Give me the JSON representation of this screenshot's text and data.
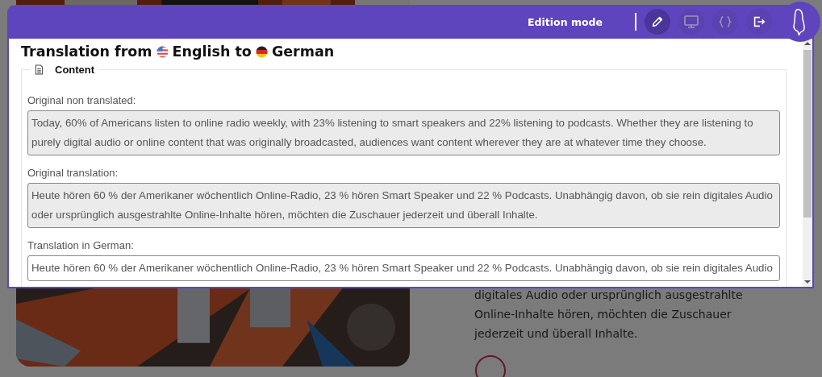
{
  "page": {
    "paragraph_lines": [
      "digitales Audio oder ursprünglich ausgestrahlte",
      "Online-Inhalte hören, möchten die Zuschauer",
      "jederzeit und überall Inhalte."
    ]
  },
  "toolbar": {
    "mode_label": "Edition mode",
    "tools": [
      {
        "kind": "edit",
        "selected": true
      },
      {
        "kind": "preview",
        "selected": false
      },
      {
        "kind": "code",
        "selected": false
      },
      {
        "kind": "exit",
        "selected": false
      }
    ]
  },
  "dialog": {
    "title_parts": [
      "Translation from",
      "English to",
      "German"
    ],
    "section": "Content",
    "fields": [
      {
        "label": "Original non translated:",
        "readonly": true,
        "value": "Today, 60% of Americans listen to online radio weekly, with 23% listening to smart speakers and 22% listening to podcasts. Whether they are listening to purely digital audio or online content that was originally broadcasted, audiences want content wherever they are at whatever time they choose."
      },
      {
        "label": "Original translation:",
        "readonly": true,
        "value": "Heute hören 60 % der Amerikaner wöchentlich Online-Radio, 23 % hören Smart Speaker und 22 % Podcasts. Unabhängig davon, ob sie rein digitales Audio oder ursprünglich ausgestrahlte Online-Inhalte hören, möchten die Zuschauer jederzeit und überall Inhalte."
      },
      {
        "label": "Translation in German:",
        "readonly": false,
        "value": "Heute hören 60 % der Amerikaner wöchentlich Online-Radio, 23 % hören Smart Speaker und 22 % Podcasts. Unabhängig davon, ob sie rein digitales Audio"
      }
    ]
  }
}
